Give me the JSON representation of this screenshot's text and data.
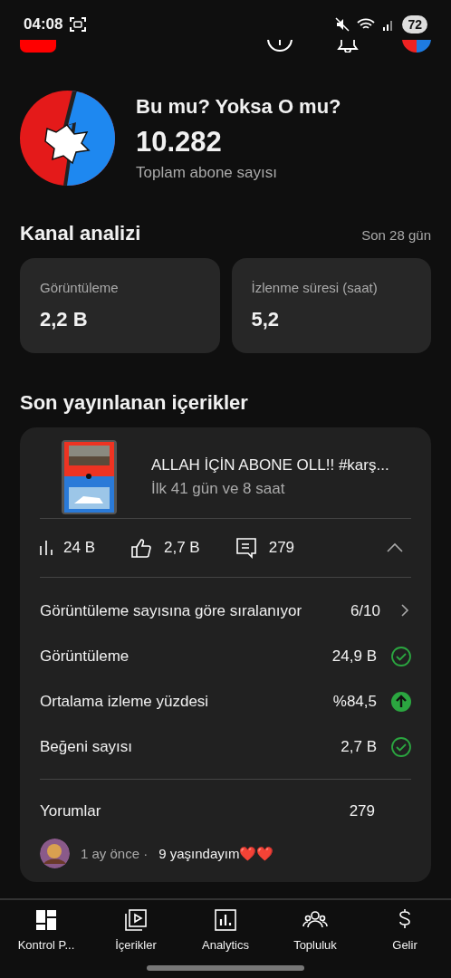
{
  "status_bar": {
    "time": "04:08",
    "battery": "72"
  },
  "channel": {
    "name": "Bu mu? Yoksa O mu?",
    "subscribers": "10.282",
    "subscribers_label": "Toplam abone sayısı"
  },
  "channel_analytics": {
    "title": "Kanal analizi",
    "period": "Son 28 gün",
    "cards": [
      {
        "label": "Görüntüleme",
        "value": "2,2 B"
      },
      {
        "label": "İzlenme süresi (saat)",
        "value": "5,2"
      }
    ]
  },
  "latest_content": {
    "title": "Son yayınlanan içerikler",
    "video": {
      "title": "ALLAH İÇİN ABONE OLL!! #karş...",
      "subtitle": "İlk 41 gün ve 8 saat"
    },
    "stats": [
      {
        "kind": "views",
        "value": "24 B"
      },
      {
        "kind": "likes",
        "value": "2,7 B"
      },
      {
        "kind": "comments",
        "value": "279"
      }
    ],
    "expanded": true,
    "metrics": [
      {
        "label": "Görüntüleme sayısına göre sıralanıyor",
        "value": "6/10",
        "kind": "chevron"
      },
      {
        "label": "Görüntüleme",
        "value": "24,9 B",
        "kind": "check"
      },
      {
        "label": "Ortalama izleme yüzdesi",
        "value": "%84,5",
        "kind": "up"
      },
      {
        "label": "Beğeni sayısı",
        "value": "2,7 B",
        "kind": "check"
      }
    ],
    "comments": {
      "label": "Yorumlar",
      "count": "279",
      "latest": {
        "time": "1 ay önce ·",
        "text": "9 yaşındayım❤️❤️"
      }
    }
  },
  "nav": [
    {
      "label": "Kontrol P...",
      "kind": "dashboard",
      "selected": true
    },
    {
      "label": "İçerikler",
      "kind": "content",
      "selected": false
    },
    {
      "label": "Analytics",
      "kind": "analytics",
      "selected": false
    },
    {
      "label": "Topluluk",
      "kind": "community",
      "selected": false
    },
    {
      "label": "Gelir",
      "kind": "earn",
      "selected": false
    }
  ]
}
